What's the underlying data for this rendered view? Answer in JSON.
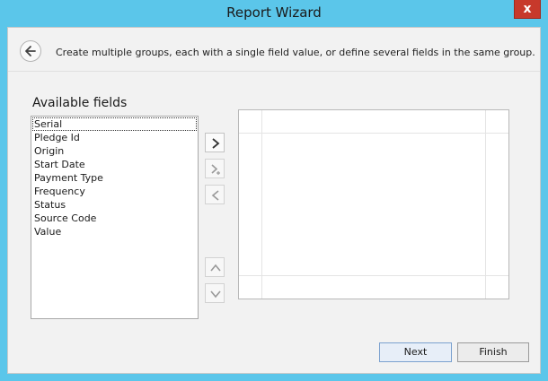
{
  "window": {
    "title": "Report Wizard",
    "close_label": "x"
  },
  "description": "Create multiple groups, each with a single field value, or define several fields in the same group.",
  "available_fields": {
    "label": "Available fields",
    "items": [
      "Serial",
      "Pledge Id",
      "Origin",
      "Start Date",
      "Payment Type",
      "Frequency",
      "Status",
      "Source Code",
      "Value"
    ],
    "selected": "Serial"
  },
  "buttons": {
    "next": "Next",
    "finish": "Finish"
  },
  "icons": {
    "back": "arrow-left-icon",
    "add": "chevron-right-icon",
    "add_to_group": "chevron-right-plus-icon",
    "remove": "chevron-left-icon",
    "move_up": "chevron-up-icon",
    "move_down": "chevron-down-icon"
  }
}
